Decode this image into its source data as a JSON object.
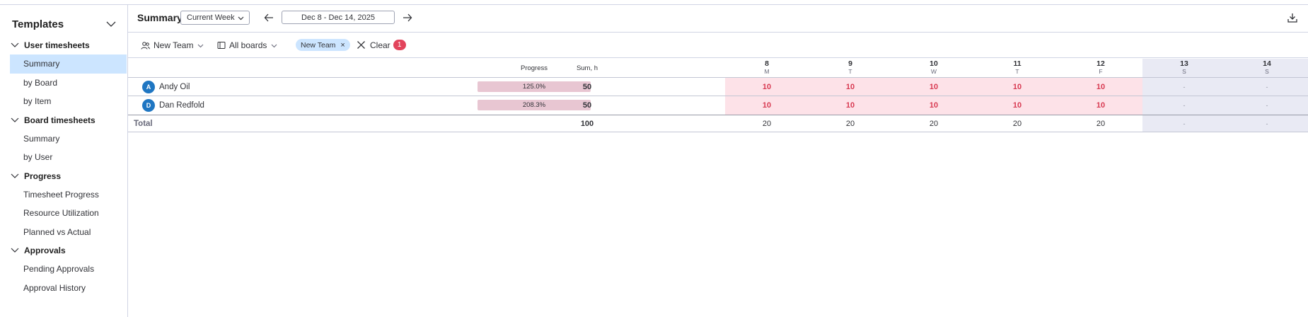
{
  "sidebar": {
    "title": "Templates",
    "groups": [
      {
        "label": "User timesheets",
        "items": [
          {
            "label": "Summary"
          },
          {
            "label": "by Board"
          },
          {
            "label": "by Item"
          }
        ]
      },
      {
        "label": "Board timesheets",
        "items": [
          {
            "label": "Summary"
          },
          {
            "label": "by User"
          }
        ]
      },
      {
        "label": "Progress",
        "items": [
          {
            "label": "Timesheet Progress"
          },
          {
            "label": "Resource Utilization"
          },
          {
            "label": "Planned vs Actual"
          }
        ]
      },
      {
        "label": "Approvals",
        "items": [
          {
            "label": "Pending Approvals"
          },
          {
            "label": "Approval History"
          }
        ]
      }
    ],
    "active_item": "User timesheets / Summary"
  },
  "header": {
    "title": "Summary",
    "period_select": "Current Week",
    "date_range": "Dec 8 - Dec 14, 2025",
    "icons": [
      "arrow-left-icon",
      "arrow-right-icon",
      "download-icon"
    ]
  },
  "filters": {
    "team_label": "New Team",
    "boards_label": "All boards",
    "chip_label": "New Team",
    "chip_remove": "×",
    "clear_label": "Clear",
    "clear_count": "1"
  },
  "table": {
    "columns": {
      "progress": "Progress",
      "sum": "Sum, h",
      "days": [
        {
          "num": "8",
          "wd": "M"
        },
        {
          "num": "9",
          "wd": "T"
        },
        {
          "num": "10",
          "wd": "W"
        },
        {
          "num": "11",
          "wd": "T"
        },
        {
          "num": "12",
          "wd": "F"
        },
        {
          "num": "13",
          "wd": "S"
        },
        {
          "num": "14",
          "wd": "S"
        }
      ]
    },
    "rows": [
      {
        "initial": "A",
        "name": "Andy Oil",
        "progress": "125.0%",
        "sum": "50",
        "days": [
          "10",
          "10",
          "10",
          "10",
          "10",
          "-",
          "-"
        ]
      },
      {
        "initial": "D",
        "name": "Dan Redfold",
        "progress": "208.3%",
        "sum": "50",
        "days": [
          "10",
          "10",
          "10",
          "10",
          "10",
          "-",
          "-"
        ]
      }
    ],
    "total": {
      "label": "Total",
      "sum": "100",
      "days": [
        "20",
        "20",
        "20",
        "20",
        "20",
        "-",
        "-"
      ]
    }
  },
  "colors": {
    "accent": "#1f76c2",
    "active_bg": "#cce5ff",
    "over_bg": "#fde2e8",
    "weekend_bg": "#e9eaf4",
    "over_text": "#d83a52",
    "badge": "#e2445c"
  }
}
